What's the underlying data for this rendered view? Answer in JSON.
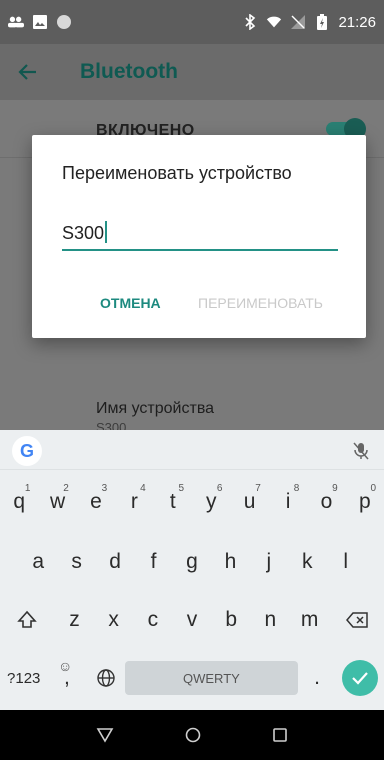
{
  "status_bar": {
    "time": "21:26",
    "icons": [
      "people-icon",
      "image-icon",
      "circle-icon",
      "bluetooth-icon",
      "wifi-icon",
      "no-signal-icon",
      "battery-icon"
    ]
  },
  "app_bar": {
    "title": "Bluetooth",
    "back_icon": "arrow-left-icon"
  },
  "background": {
    "enabled_label": "ВКЛЮЧЕНО",
    "device_name_title": "Имя устройства",
    "device_name_value": "S300"
  },
  "dialog": {
    "title": "Переименовать устройство",
    "input_value": "S300",
    "cancel_label": "ОТМЕНА",
    "rename_label": "ПЕРЕИМЕНОВАТЬ"
  },
  "keyboard": {
    "google_label": "G",
    "row1": [
      {
        "k": "q",
        "h": "1"
      },
      {
        "k": "w",
        "h": "2"
      },
      {
        "k": "e",
        "h": "3"
      },
      {
        "k": "r",
        "h": "4"
      },
      {
        "k": "t",
        "h": "5"
      },
      {
        "k": "y",
        "h": "6"
      },
      {
        "k": "u",
        "h": "7"
      },
      {
        "k": "i",
        "h": "8"
      },
      {
        "k": "o",
        "h": "9"
      },
      {
        "k": "p",
        "h": "0"
      }
    ],
    "row2": [
      "a",
      "s",
      "d",
      "f",
      "g",
      "h",
      "j",
      "k",
      "l"
    ],
    "row3": [
      "z",
      "x",
      "c",
      "v",
      "b",
      "n",
      "m"
    ],
    "symbols_label": "?123",
    "emoji_label": "☺",
    "comma_label": ",",
    "space_label": "QWERTY",
    "period_label": "."
  },
  "nav_bar": {
    "icons": [
      "back-triangle-icon",
      "home-circle-icon",
      "recents-square-icon"
    ]
  },
  "colors": {
    "accent": "#1d8a7f",
    "title_teal": "#0f5a52",
    "enter_key": "#3fbda8"
  }
}
